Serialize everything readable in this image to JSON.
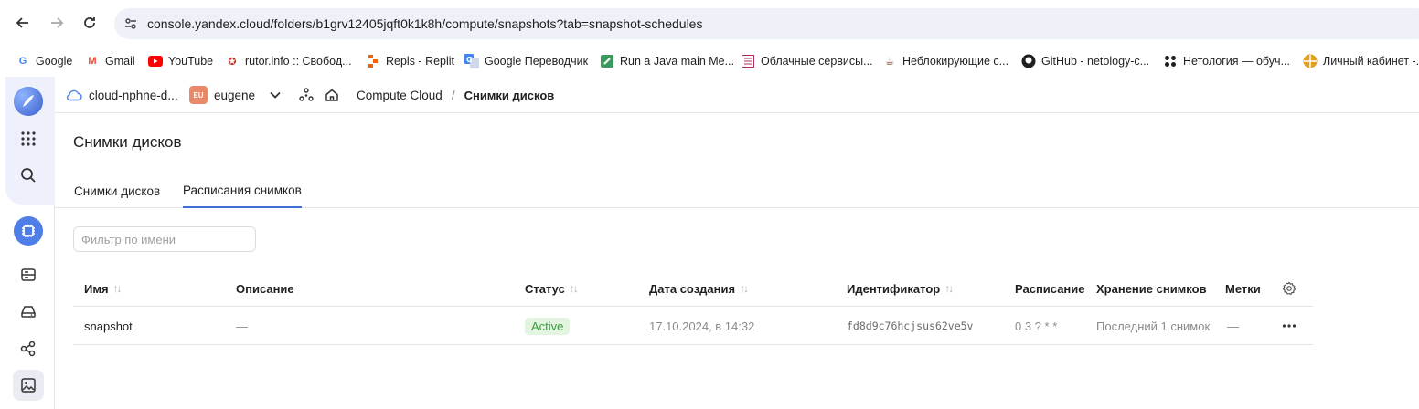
{
  "browser": {
    "url": "console.yandex.cloud/folders/b1grv12405jqft0k1k8h/compute/snapshots?tab=snapshot-schedules",
    "bookmarks": [
      {
        "label": "Google",
        "icon": "google-icon",
        "color": "#4285f4"
      },
      {
        "label": "Gmail",
        "icon": "gmail-icon",
        "color": "#ea4335"
      },
      {
        "label": "YouTube",
        "icon": "youtube-icon",
        "color": "#ff0000"
      },
      {
        "label": "rutor.info :: Свобод...",
        "icon": "rutor-icon",
        "color": "#c0392b"
      },
      {
        "label": "Repls - Replit",
        "icon": "replit-icon",
        "color": "#f26207"
      },
      {
        "label": "Google Переводчик",
        "icon": "translate-icon",
        "color": "#4285f4"
      },
      {
        "label": "Run a Java main Me...",
        "icon": "java-icon",
        "color": "#3c9a5f"
      },
      {
        "label": "Облачные сервисы...",
        "icon": "cloud-services-icon",
        "color": "#b03060"
      },
      {
        "label": "Неблокирующие с...",
        "icon": "coffee-icon",
        "color": "#7a4a2a"
      },
      {
        "label": "GitHub - netology-c...",
        "icon": "github-icon",
        "color": "#1f1f1f"
      },
      {
        "label": "Нетология — обуч...",
        "icon": "netology-icon",
        "color": "#1f1f1f"
      },
      {
        "label": "Личный кабинет -...",
        "icon": "cabinet-icon",
        "color": "#e0a020"
      }
    ]
  },
  "header": {
    "cloud": "cloud-nphne-d...",
    "user_badge": "EU",
    "user": "eugene",
    "breadcrumb_service": "Compute Cloud",
    "breadcrumb_separator": "/",
    "breadcrumb_current": "Снимки дисков"
  },
  "page": {
    "title": "Снимки дисков",
    "tabs": [
      {
        "label": "Снимки дисков",
        "active": false
      },
      {
        "label": "Расписания снимков",
        "active": true
      }
    ],
    "filter_placeholder": "Фильтр по имени"
  },
  "table": {
    "columns": [
      "Имя",
      "Описание",
      "Статус",
      "Дата создания",
      "Идентификатор",
      "Расписание",
      "Хранение снимков",
      "Метки"
    ],
    "rows": [
      {
        "name": "snapshot",
        "description": "—",
        "status": "Active",
        "created": "17.10.2024, в 14:32",
        "id": "fd8d9c76hcjsus62ve5v",
        "schedule": "0 3 ? * *",
        "retention": "Последний 1 снимок",
        "labels": "—"
      }
    ]
  },
  "colors": {
    "accent": "#3f6fd8",
    "status_active_bg": "#e3f5e1",
    "status_active_fg": "#3c9a3c"
  }
}
